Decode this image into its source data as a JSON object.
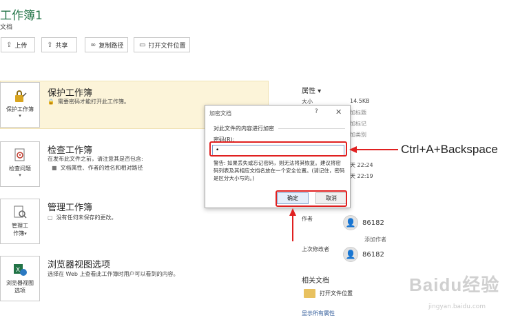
{
  "header": {
    "title": "工作簿1",
    "subtitle": "文档"
  },
  "toolbar": [
    {
      "label": "上传",
      "icon": "upload-icon"
    },
    {
      "label": "共享",
      "icon": "share-icon"
    },
    {
      "label": "复制路径",
      "icon": "link-icon"
    },
    {
      "label": "打开文件位置",
      "icon": "folder-icon"
    }
  ],
  "sections": {
    "protect": {
      "button_label": "保护工作簿",
      "title": "保护工作簿",
      "desc": "需要密码才能打开此工作簿。"
    },
    "inspect": {
      "button_label": "检查问题",
      "title": "检查工作簿",
      "desc": "在发布此文件之前，请注意其是否包含:",
      "bullet": "文档属性、作者的姓名和相对路径"
    },
    "manage": {
      "button_label_1": "管理工",
      "button_label_2": "作簿",
      "title": "管理工作簿",
      "desc": "没有任何未保存的更改。"
    },
    "browser": {
      "button_label_1": "浏览器视图",
      "button_label_2": "选项",
      "title": "浏览器视图选项",
      "desc": "选择在 Web 上查看此工作簿时用户可以看到的内容。"
    }
  },
  "properties": {
    "heading": "属性 ▾",
    "size_label": "大小",
    "size_value": "14.5KB",
    "v1": "加标题",
    "v2": "加标记",
    "v3": "加类别",
    "time1": "天 22:24",
    "time2": "天 22:19",
    "author_label": "作者",
    "author_name": "86182",
    "add_author": "添加作者",
    "modifier_label": "上次修改者",
    "modifier_name": "86182",
    "related_heading": "相关文档",
    "open_location": "打开文件位置",
    "show_all": "显示所有属性"
  },
  "dialog": {
    "title": "加密文档",
    "help": "?",
    "close": "✕",
    "section": "对此文件的内容进行加密",
    "password_label": "密码(R):",
    "password_value": "•",
    "warning": "警告: 如果丢失或忘记密码，则无法将其恢复。建议将密码列表及其相应文档名放在一个安全位置。(请记住，密码是区分大小写的。)",
    "ok": "确定",
    "cancel": "取消"
  },
  "annotation": {
    "text": "Ctrl+A+Backspace",
    "color": "#e02020"
  },
  "watermark": {
    "logo": "Baidu经验",
    "url": "jingyan.baidu.com"
  },
  "colors": {
    "accent": "#217346",
    "highlight_bg": "#fcf4d9",
    "link": "#2b5797"
  }
}
